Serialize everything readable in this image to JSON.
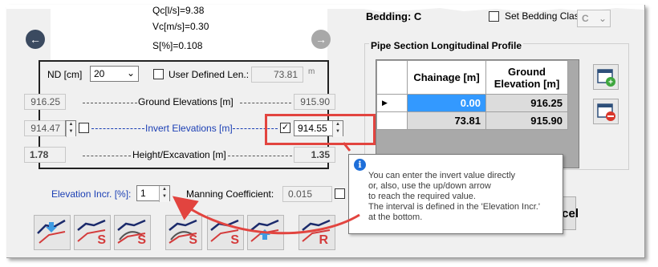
{
  "top_info": {
    "qc": "Qc[l/s]=9.38",
    "vc": "Vc[m/s]=0.30",
    "s": "S[%]=0.108"
  },
  "bedding": {
    "label": "Bedding: C",
    "set_class_label": "Set Bedding Class:",
    "class_value": "C"
  },
  "profile": {
    "title": "Pipe Section Longitudinal Profile",
    "columns": [
      "Chainage [m]",
      "Ground Elevation [m]"
    ],
    "rows": [
      {
        "chainage": "0.00",
        "elevation": "916.25"
      },
      {
        "chainage": "73.81",
        "elevation": "915.90"
      }
    ]
  },
  "pipe": {
    "nd_label": "ND [cm]",
    "nd_value": "20",
    "user_len_label": "User Defined Len.:",
    "user_len_value": "73.81",
    "user_len_unit": "m"
  },
  "rows": {
    "ground_label": "Ground Elevations [m]",
    "ground_left": "916.25",
    "ground_right": "915.90",
    "invert_label": "Invert Elevations [m]",
    "invert_left": "914.47",
    "invert_right": "914.55",
    "height_label": "Height/Excavation [m]",
    "height_left": "1.78",
    "height_right": "1.35"
  },
  "bottom": {
    "elev_incr_label": "Elevation Incr. [%]:",
    "elev_incr_value": "1",
    "manning_label": "Manning Coefficient:",
    "manning_value": "0.015",
    "cancel_label": "ncel"
  },
  "tooltip": {
    "lines": [
      "You can enter the invert value directly",
      "or, also, use the up/down arrow",
      "to reach the required value.",
      "The interval is defined in the 'Elevation Incr.'",
      "at the bottom."
    ]
  },
  "tool_letters": {
    "b2": "S",
    "b3": "S",
    "b4": "S",
    "b5": "S",
    "b7": "R"
  },
  "colors": {
    "highlight_red": "#e2443f",
    "blue_text": "#1b3fb4",
    "selected_cell": "#3399ff",
    "info_blue": "#1e6fd9"
  }
}
